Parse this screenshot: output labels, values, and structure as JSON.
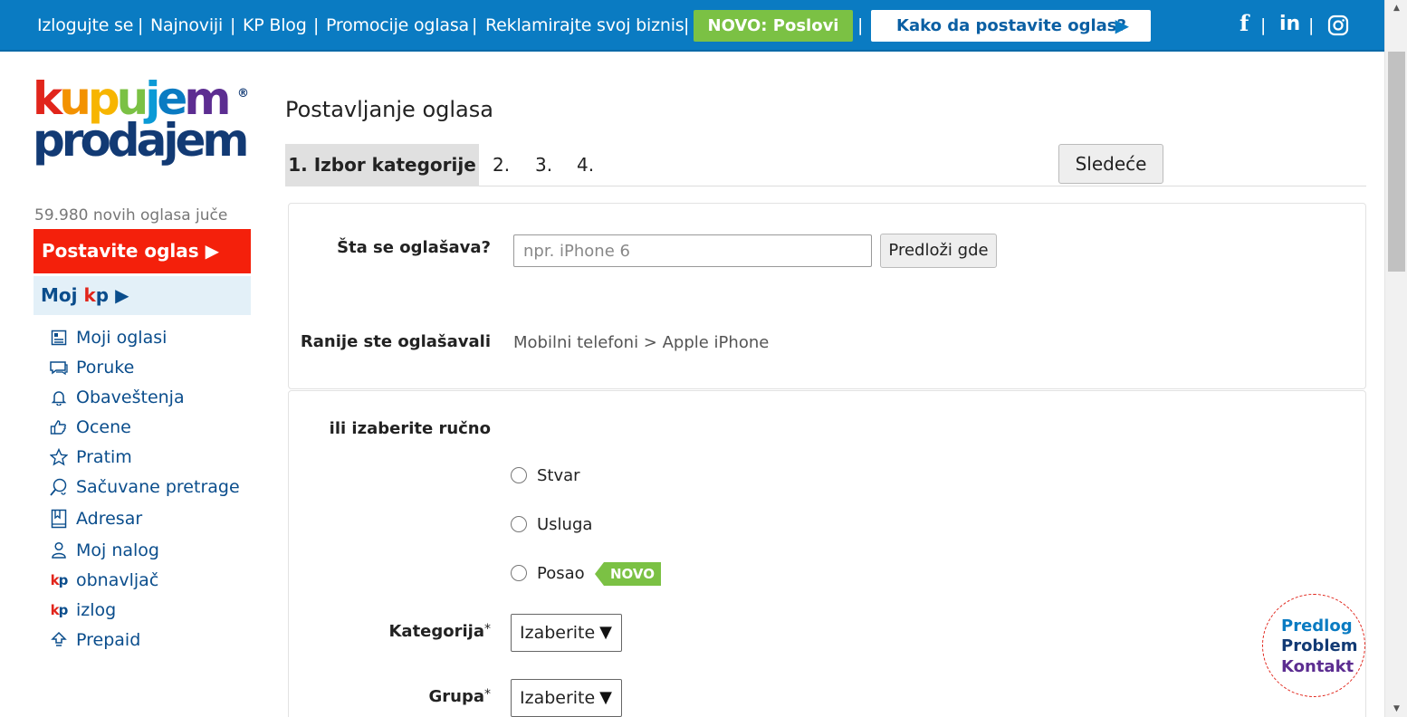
{
  "topbar": {
    "links": [
      "Izlogujte se",
      "Najnoviji",
      "KP Blog",
      "Promocije oglasa",
      "Reklamirajte svoj biznis"
    ],
    "separator": "|",
    "novo_button": "NOVO: Poslovi",
    "how_to_button": "Kako da postavite oglas?",
    "how_to_arrow": "▶",
    "social_icons": [
      "facebook-icon",
      "linkedin-icon",
      "instagram-icon"
    ],
    "social_glyphs": {
      "facebook": "f",
      "linkedin": "in"
    },
    "colors": {
      "bar": "#0a7bc2",
      "novo": "#7bc144"
    }
  },
  "logo": {
    "line1": "kupujem",
    "line2": "prodajem",
    "registered": "®"
  },
  "sidebar": {
    "new_ads_text": "59.980 novih oglasa juče",
    "post_ad_button": "Postavite oglas ▶",
    "moj_kp": {
      "prefix": "Moj ",
      "k": "k",
      "p": "p",
      "arrow": " ▶"
    },
    "items": [
      {
        "label": "Moji oglasi",
        "icon": "my-ads-icon"
      },
      {
        "label": "Poruke",
        "icon": "messages-icon"
      },
      {
        "label": "Obaveštenja",
        "icon": "bell-icon"
      },
      {
        "label": "Ocene",
        "icon": "thumbs-up-icon"
      },
      {
        "label": "Pratim",
        "icon": "star-icon"
      },
      {
        "label": "Sačuvane pretrage",
        "icon": "saved-search-icon"
      },
      {
        "label": "Adresar",
        "icon": "address-book-icon"
      },
      {
        "label": "Moj nalog",
        "icon": "user-icon"
      },
      {
        "label": "obnavljač",
        "icon": "kp-logo-icon"
      },
      {
        "label": "izlog",
        "icon": "kp-logo-icon"
      },
      {
        "label": "Prepaid",
        "icon": "prepaid-icon"
      }
    ],
    "kp_icon": {
      "k": "k",
      "p": "p"
    },
    "colors": {
      "post_ad": "#f4200b",
      "moj_kp_bg": "#e3f0f8",
      "link": "#0a4d8c"
    }
  },
  "main": {
    "title": "Postavljanje oglasa",
    "steps": [
      "1. Izbor kategorije",
      "2.",
      "3.",
      "4."
    ],
    "next_button": "Sledeće",
    "what_label": "Šta se oglašava?",
    "search_placeholder": "npr. iPhone 6",
    "search_value": "",
    "suggest_button": "Predloži gde",
    "previous_label": "Ranije ste oglašavali",
    "previous_category": "Mobilni telefoni > Apple iPhone",
    "manual_label": "ili izaberite ručno",
    "radio_options": [
      "Stvar",
      "Usluga",
      "Posao"
    ],
    "novo_badge": "NOVO",
    "category_label": "Kategorija",
    "group_label": "Grupa",
    "required_mark": "*",
    "select_value": "Izaberite",
    "select_caret": "▼"
  },
  "feedback": {
    "lines": [
      "Predlog",
      "Problem",
      "Kontakt"
    ]
  }
}
